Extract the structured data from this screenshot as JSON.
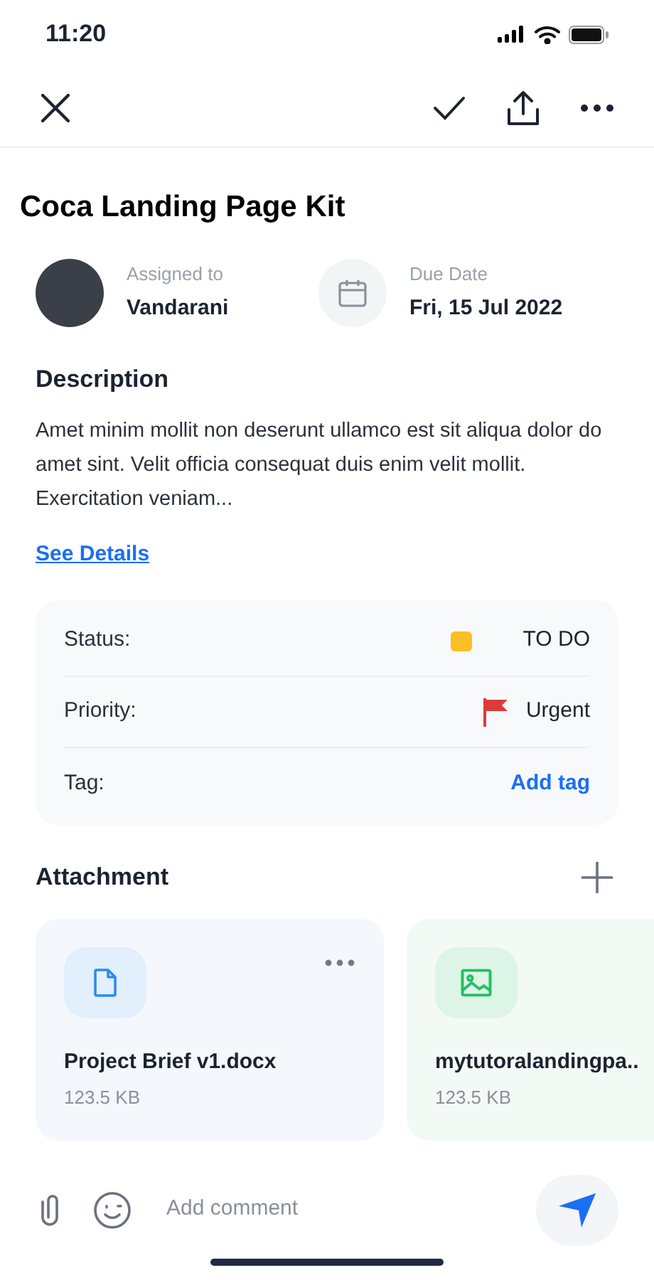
{
  "status_bar": {
    "time": "11:20"
  },
  "task": {
    "title": "Coca Landing Page Kit",
    "assignee_label": "Assigned to",
    "assignee": "Vandarani",
    "due_label": "Due Date",
    "due": "Fri, 15 Jul 2022"
  },
  "description": {
    "heading": "Description",
    "text": "Amet minim mollit non deserunt ullamco est sit aliqua dolor do amet sint. Velit officia consequat duis enim velit mollit. Exercitation veniam...",
    "link": "See Details"
  },
  "properties": [
    {
      "kind": "status",
      "label": "Status:",
      "value": "TO DO",
      "color": "#fbbf24"
    },
    {
      "kind": "priority",
      "label": "Priority:",
      "value": "Urgent",
      "color": "#dc3b3b"
    },
    {
      "kind": "link",
      "label": "Tag:",
      "value": "Add tag"
    }
  ],
  "attachments": {
    "heading": "Attachment",
    "items": [
      {
        "kind": "document",
        "name": "Project Brief v1.docx",
        "size": "123.5 KB"
      },
      {
        "kind": "image",
        "name": "mytutoralandingpa..",
        "size": "123.5 KB"
      }
    ]
  },
  "comment": {
    "placeholder": "Add comment"
  }
}
